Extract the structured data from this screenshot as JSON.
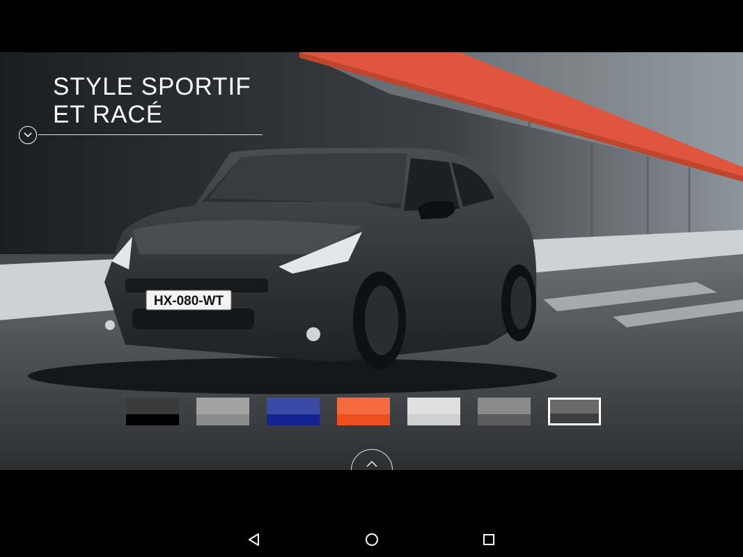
{
  "hero": {
    "headline_line1": "STYLE SPORTIF",
    "headline_line2": "ET RACÉ",
    "license_plate": "HX-080-WT",
    "icons": {
      "expand": "chevron-down-icon",
      "collapse": "chevron-up-icon"
    }
  },
  "swatches": [
    {
      "top": "#3a3a3a",
      "bottom": "#000000",
      "selected": false
    },
    {
      "top": "#a3a3a3",
      "bottom": "#8a8a8a",
      "selected": false
    },
    {
      "top": "#3b4aa5",
      "bottom": "#14238f",
      "selected": false
    },
    {
      "top": "#f66a40",
      "bottom": "#ee4d1e",
      "selected": false
    },
    {
      "top": "#e0e0e0",
      "bottom": "#d0d0d0",
      "selected": false
    },
    {
      "top": "#8a8a8a",
      "bottom": "#5c5c5c",
      "selected": false
    },
    {
      "top": "#6a6a6a",
      "bottom": "#3e3e3e",
      "selected": true
    }
  ],
  "nav": {
    "back_icon": "back-triangle-icon",
    "home_icon": "home-circle-icon",
    "recents_icon": "recents-square-icon"
  }
}
